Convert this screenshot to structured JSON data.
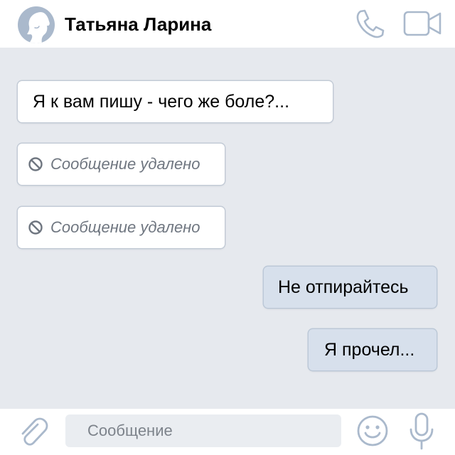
{
  "header": {
    "contact_name": "Татьяна Ларина",
    "avatar_icon": "profile-silhouette-icon",
    "call_icon": "phone-icon",
    "video_icon": "video-camera-icon"
  },
  "messages": [
    {
      "direction": "incoming",
      "text": "Я к вам пишу - чего же боле?...",
      "deleted": false
    },
    {
      "direction": "incoming",
      "text": "Сообщение удалено",
      "deleted": true,
      "icon": "ban-icon"
    },
    {
      "direction": "incoming",
      "text": "Сообщение удалено",
      "deleted": true,
      "icon": "ban-icon"
    },
    {
      "direction": "outgoing",
      "text": "Не отпирайтесь",
      "deleted": false
    },
    {
      "direction": "outgoing",
      "text": "Я прочел...",
      "deleted": false
    }
  ],
  "composer": {
    "placeholder": "Сообщение",
    "value": "",
    "attach_icon": "paperclip-icon",
    "emoji_icon": "smiley-icon",
    "mic_icon": "microphone-icon"
  },
  "colors": {
    "accent": "#aab9cc",
    "chat_background": "#e6e9ee",
    "incoming_bubble": "#ffffff",
    "outgoing_bubble": "#d7e0ec"
  }
}
